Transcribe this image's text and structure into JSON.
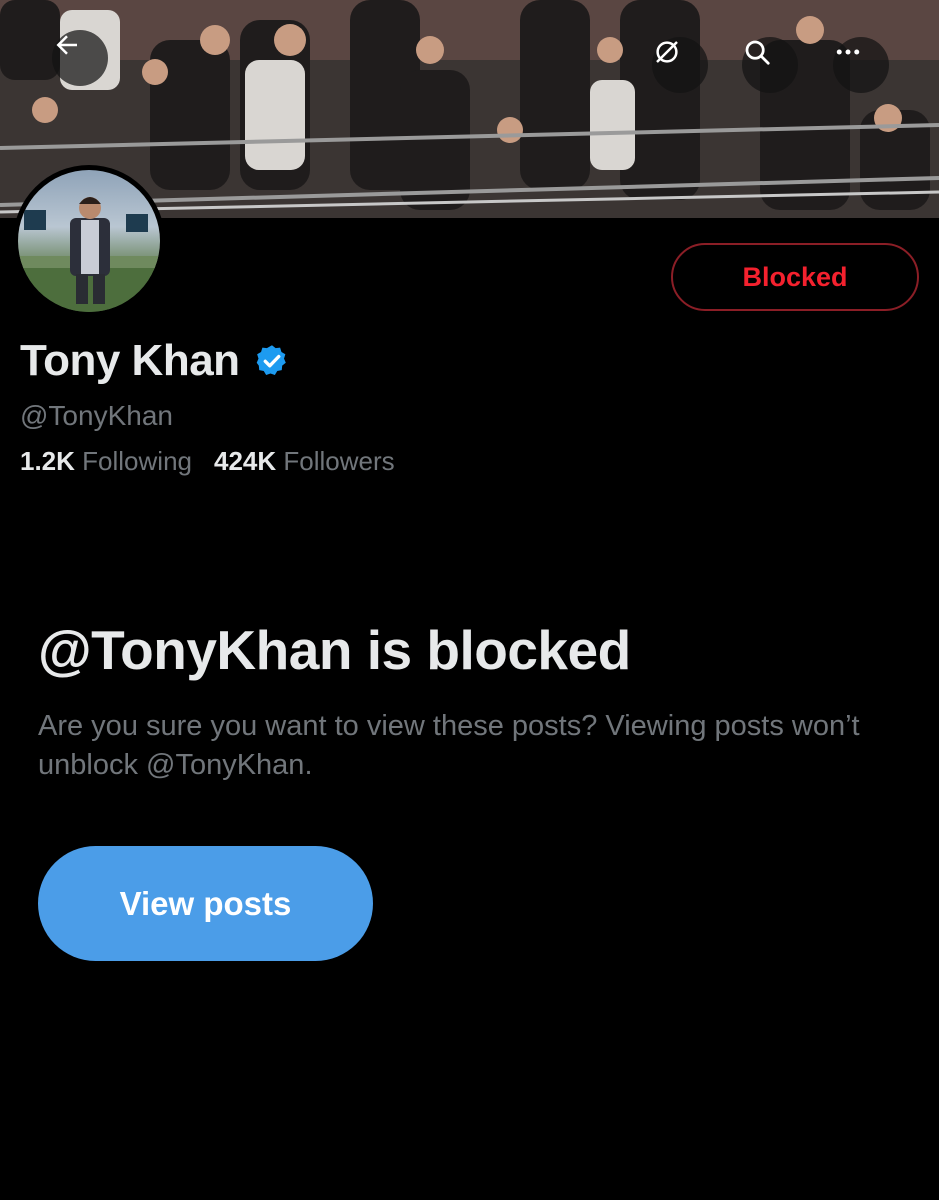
{
  "header": {
    "back_icon": "arrow-left-icon",
    "grok_icon": "grok-icon",
    "search_icon": "search-icon",
    "more_icon": "more-icon"
  },
  "profile": {
    "display_name": "Tony Khan",
    "handle": "@TonyKhan",
    "verified_icon": "verified-badge-icon",
    "following_count": "1.2K",
    "following_label": "Following",
    "followers_count": "424K",
    "followers_label": "Followers",
    "blocked_button_label": "Blocked"
  },
  "blocked_notice": {
    "title": "@TonyKhan is blocked",
    "description": "Are you sure you want to view these posts? Viewing posts won’t unblock @TonyKhan.",
    "view_button_label": "View posts"
  },
  "colors": {
    "background": "#000000",
    "primary_text": "#e7e9ea",
    "secondary_text": "#71767b",
    "blocked_red": "#f4212e",
    "accent_blue": "#4b9de8",
    "verified_blue": "#1d9bf0"
  }
}
